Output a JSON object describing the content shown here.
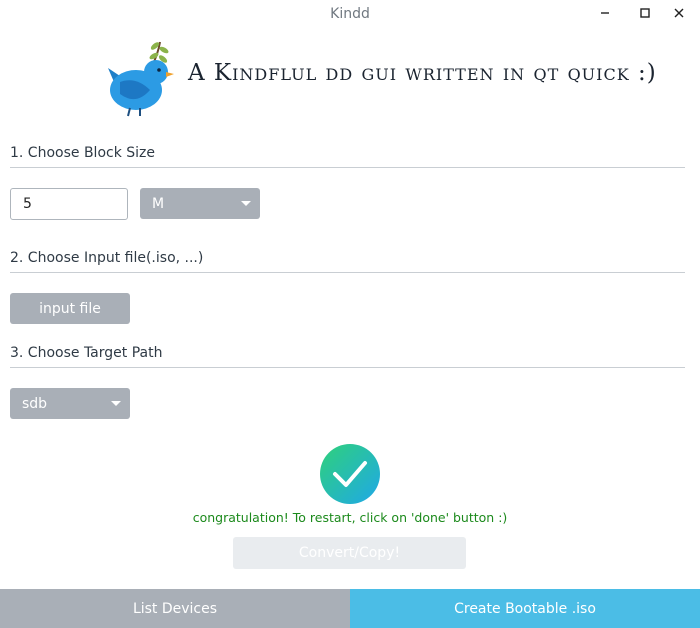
{
  "window": {
    "title": "Kindd",
    "controls": [
      "minimize-icon",
      "maximize-icon",
      "close-icon"
    ]
  },
  "header": {
    "logo_icon": "bird-with-olive-branch-icon",
    "tagline": "A Kindflul dd gui written in qt quick :)"
  },
  "step1": {
    "label": "1. Choose Block Size",
    "block_size_value": "5",
    "unit_selected": "M"
  },
  "step2": {
    "label": "2. Choose Input file(.iso, ...)",
    "button_label": "input file"
  },
  "step3": {
    "label": "3. Choose Target Path",
    "target_selected": "sdb"
  },
  "status": {
    "icon": "check-circle-icon",
    "message": "congratulation! To restart, click on 'done' button :)",
    "color": "#1c8a1c"
  },
  "actions": {
    "convert_label": "Convert/Copy!",
    "list_devices_label": "List Devices",
    "create_bootable_label": "Create Bootable .iso"
  },
  "colors": {
    "gray_button": "#a9afb7",
    "accent_blue": "#4bbde6"
  }
}
